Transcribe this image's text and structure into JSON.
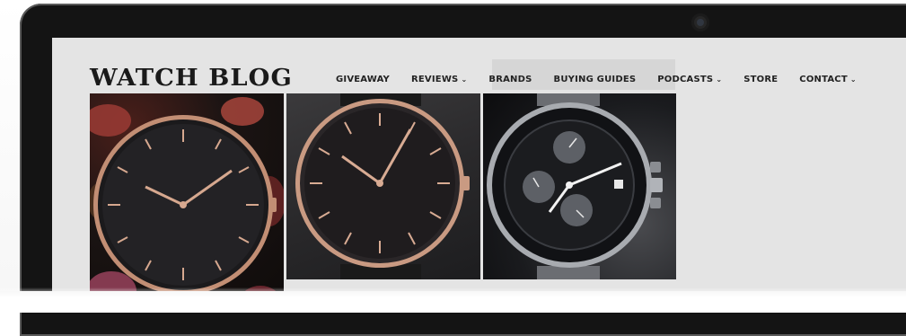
{
  "site": {
    "brand": "WATCH BLOG"
  },
  "nav": {
    "items": [
      {
        "label": "GIVEAWAY",
        "dropdown": false
      },
      {
        "label": "REVIEWS",
        "dropdown": true
      },
      {
        "label": "BRANDS",
        "dropdown": false
      },
      {
        "label": "BUYING GUIDES",
        "dropdown": false
      },
      {
        "label": "PODCASTS",
        "dropdown": true
      },
      {
        "label": "STORE",
        "dropdown": false
      },
      {
        "label": "CONTACT",
        "dropdown": true
      }
    ],
    "dropdown_glyph": "⌄"
  },
  "photos": [
    {
      "name": "minimalist-rose-gold-watch-on-flowers"
    },
    {
      "name": "minimalist-rose-gold-watch-on-black"
    },
    {
      "name": "chronograph-watch-black-dial"
    }
  ],
  "colors": {
    "screen_bg": "#e4e4e4",
    "bezel": "#141414",
    "rose_gold": "#c99a82",
    "text": "#222222"
  }
}
